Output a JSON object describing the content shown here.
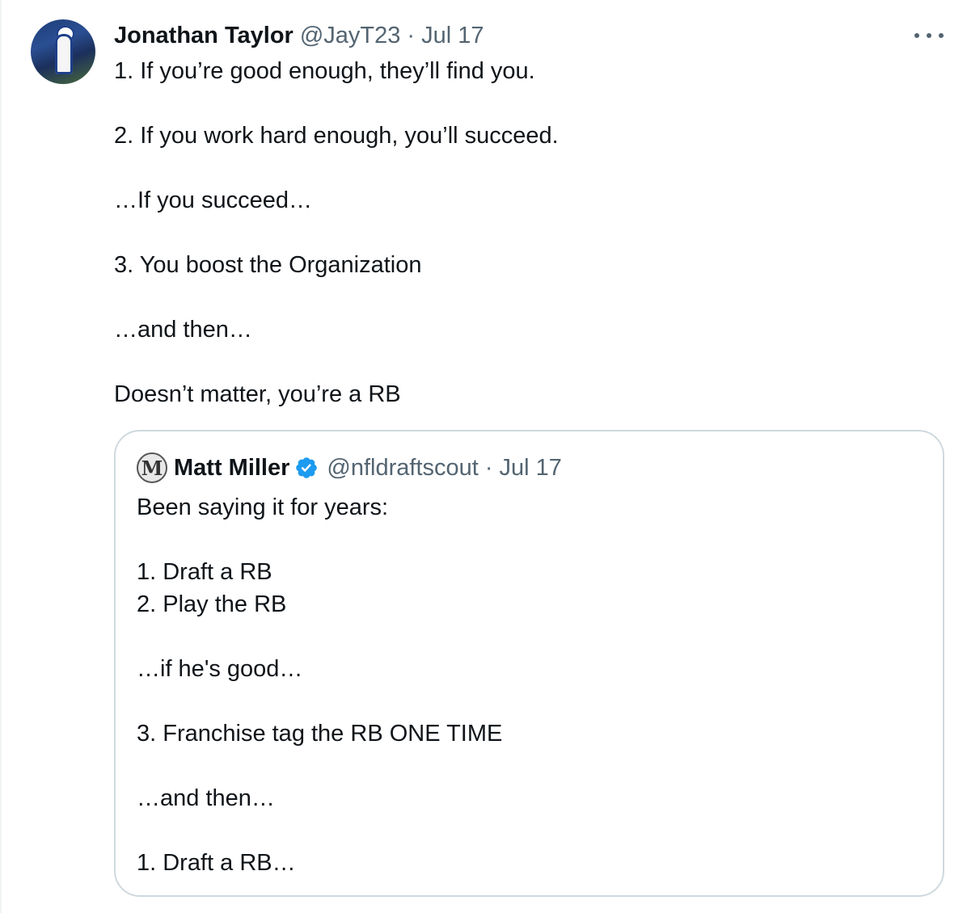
{
  "post": {
    "author_name": "Jonathan Taylor",
    "author_handle": "@JayT23",
    "separator": "·",
    "date": "Jul 17",
    "body": "1. If you’re good enough, they’ll find you.\n\n2. If you work hard enough, you’ll succeed.\n\n…If you succeed…\n\n3. You boost the Organization\n\n…and then…\n\nDoesn’t matter, you’re a RB",
    "more_icon": "more-horizontal-icon"
  },
  "quote": {
    "avatar_letter": "M",
    "author_name": "Matt Miller",
    "verified_icon": "verified-badge-icon",
    "verified_color": "#1d9bf0",
    "author_handle": "@nfldraftscout",
    "separator": "·",
    "date": "Jul 17",
    "body": "Been saying it for years:\n\n1. Draft a RB\n2. Play the RB\n\n…if he's good…\n\n3. Franchise tag the RB ONE TIME\n\n…and then…\n\n1. Draft a RB…"
  },
  "colors": {
    "text_primary": "#0f1419",
    "text_secondary": "#536471",
    "border": "#cfd9de"
  }
}
